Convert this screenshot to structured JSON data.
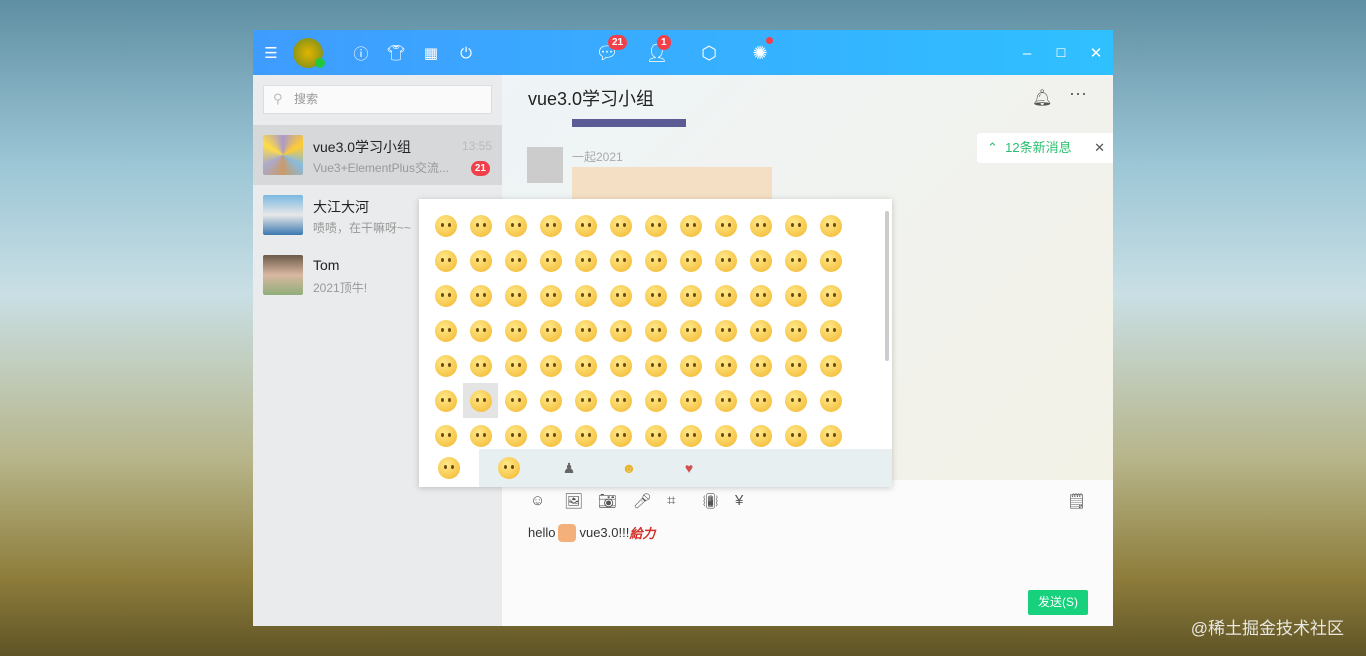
{
  "topbar": {
    "badges": {
      "messages": "21",
      "contacts": "1"
    }
  },
  "sidebar": {
    "search_placeholder": "搜索",
    "conversations": [
      {
        "name": "vue3.0学习小组",
        "preview": "Vue3+ElementPlus交流...",
        "time": "13:55",
        "unread": "21"
      },
      {
        "name": "大江大河",
        "preview": "啧啧，在干嘛呀~~"
      },
      {
        "name": "Tom",
        "preview": "2021顶牛!"
      }
    ]
  },
  "chat": {
    "title": "vue3.0学习小组",
    "sender": "一起2021",
    "new_messages": "12条新消息",
    "input_text": "hello",
    "input_text2": "vue3.0!!!",
    "send_label": "发送(S)"
  },
  "colors": {
    "accent": "#3f9cff",
    "send": "#17d17c",
    "badge": "#f2404a"
  },
  "watermark": "@稀土掘金技术社区"
}
